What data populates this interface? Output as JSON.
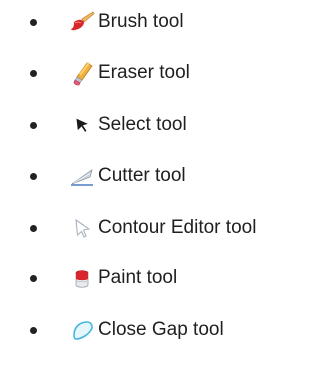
{
  "tools": [
    {
      "label": "Brush tool",
      "icon": "brush-icon",
      "accent": "#d8262b"
    },
    {
      "label": "Eraser tool",
      "icon": "eraser-icon",
      "accent": "#e8a33a"
    },
    {
      "label": "Select tool",
      "icon": "select-arrow-icon",
      "accent": "#1a1a1a"
    },
    {
      "label": "Cutter tool",
      "icon": "cutter-icon",
      "accent": "#8aa0c8"
    },
    {
      "label": "Contour Editor tool",
      "icon": "contour-editor-icon",
      "accent": "#b9c4cf"
    },
    {
      "label": "Paint tool",
      "icon": "paint-bucket-icon",
      "accent": "#d8262b"
    },
    {
      "label": "Close Gap tool",
      "icon": "close-gap-icon",
      "accent": "#45b5e0"
    }
  ]
}
